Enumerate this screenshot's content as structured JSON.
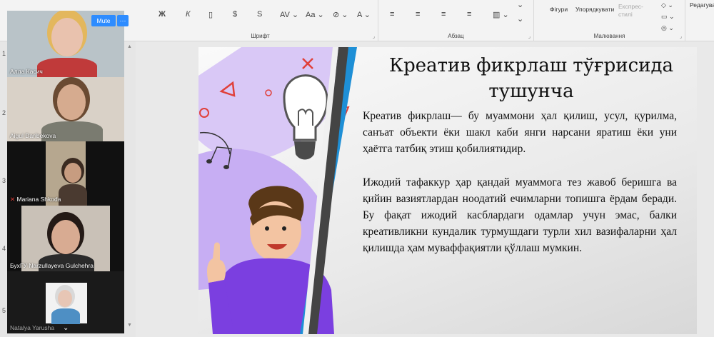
{
  "ribbon": {
    "font_group": "Шрифт",
    "paragraph_group": "Абзац",
    "drawing_group": "Малювання",
    "shapes_label": "Фігури",
    "arrange_label": "Упорядкувати",
    "express_styles_label": "Експрес-стилі",
    "editing_label": "Редагува"
  },
  "thumbnails": {
    "numbers": [
      "1",
      "2",
      "3",
      "4",
      "5"
    ]
  },
  "zoom": {
    "mute_label": "Mute",
    "more_label": "···",
    "participants": [
      {
        "name": "Алла Касич",
        "bg": "#b9c3c8",
        "skin": "#e9c2ae",
        "hair": "#e3b75d",
        "shirt": "#c03a3a"
      },
      {
        "name": "Aigul Daribekova",
        "bg": "#d9d1c7",
        "skin": "#d6ab8f",
        "hair": "#6a4a32",
        "shirt": "#7a7b70"
      },
      {
        "name": "Mariana Shkoda",
        "bg": "#b6a78f",
        "skin": "#c79c80",
        "hair": "#3a2a20",
        "shirt": "#4a3a30"
      },
      {
        "name": "БухГУ Narzullayeva Gulchehra",
        "bg": "#c9c1b7",
        "skin": "#d8ab92",
        "hair": "#241a16",
        "shirt": "#2a2a2a"
      },
      {
        "name": "Natalya Yarusha",
        "bg": "#f2f2f2",
        "skin": "#e7c6b5",
        "hair": "#d9d9d9",
        "shirt": "#4e8fc4"
      }
    ]
  },
  "slide": {
    "title": "Креатив фикрлаш тўғрисида тушунча",
    "paragraph1": "Креатив фикрлаш— бу муаммони ҳал қилиш, усул, қурилма, санъат объекти ёки шакл каби янги нарсани яратиш ёки уни ҳаётга татбиқ этиш қобилиятидир.",
    "paragraph2": "Ижодий тафаккур ҳар қандай муаммога тез жавоб беришга ва қийин вазиятлардан ноодатий ечимларни топишга ёрдам беради. Бу фақат ижодий касблардаги одамлар учун эмас, балки креативликни кундалик турмушдаги турли хил вазифаларни ҳал қилишда ҳам муваффақиятли қўллаш мумкин."
  },
  "colors": {
    "accent_blue": "#1e8fd6",
    "accent_purple": "#7b3fe0",
    "accent_red": "#e0403a",
    "zoom_blue": "#2d8cff",
    "active_green": "#27c25a"
  }
}
